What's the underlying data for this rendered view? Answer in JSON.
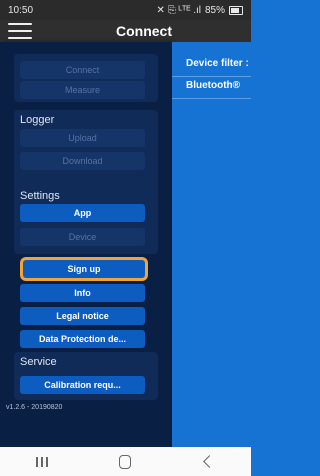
{
  "status": {
    "time": "10:50",
    "battery": "85%",
    "signal_icons": "✕ ⎘ ᴸᵀᴱ .ıl"
  },
  "appbar": {
    "title": "Connect"
  },
  "drawer": {
    "connect": "Connect",
    "measure": "Measure",
    "logger_label": "Logger",
    "upload": "Upload",
    "download": "Download",
    "settings_label": "Settings",
    "app": "App",
    "device": "Device",
    "signup": "Sign up",
    "info": "Info",
    "legal": "Legal notice",
    "data_protection": "Data Protection de...",
    "service_label": "Service",
    "calibration": "Calibration requ...",
    "version": "v1.2.6 - 20190820"
  },
  "right": {
    "device_filter": "Device filter :",
    "bluetooth": "Bluetooth®"
  }
}
